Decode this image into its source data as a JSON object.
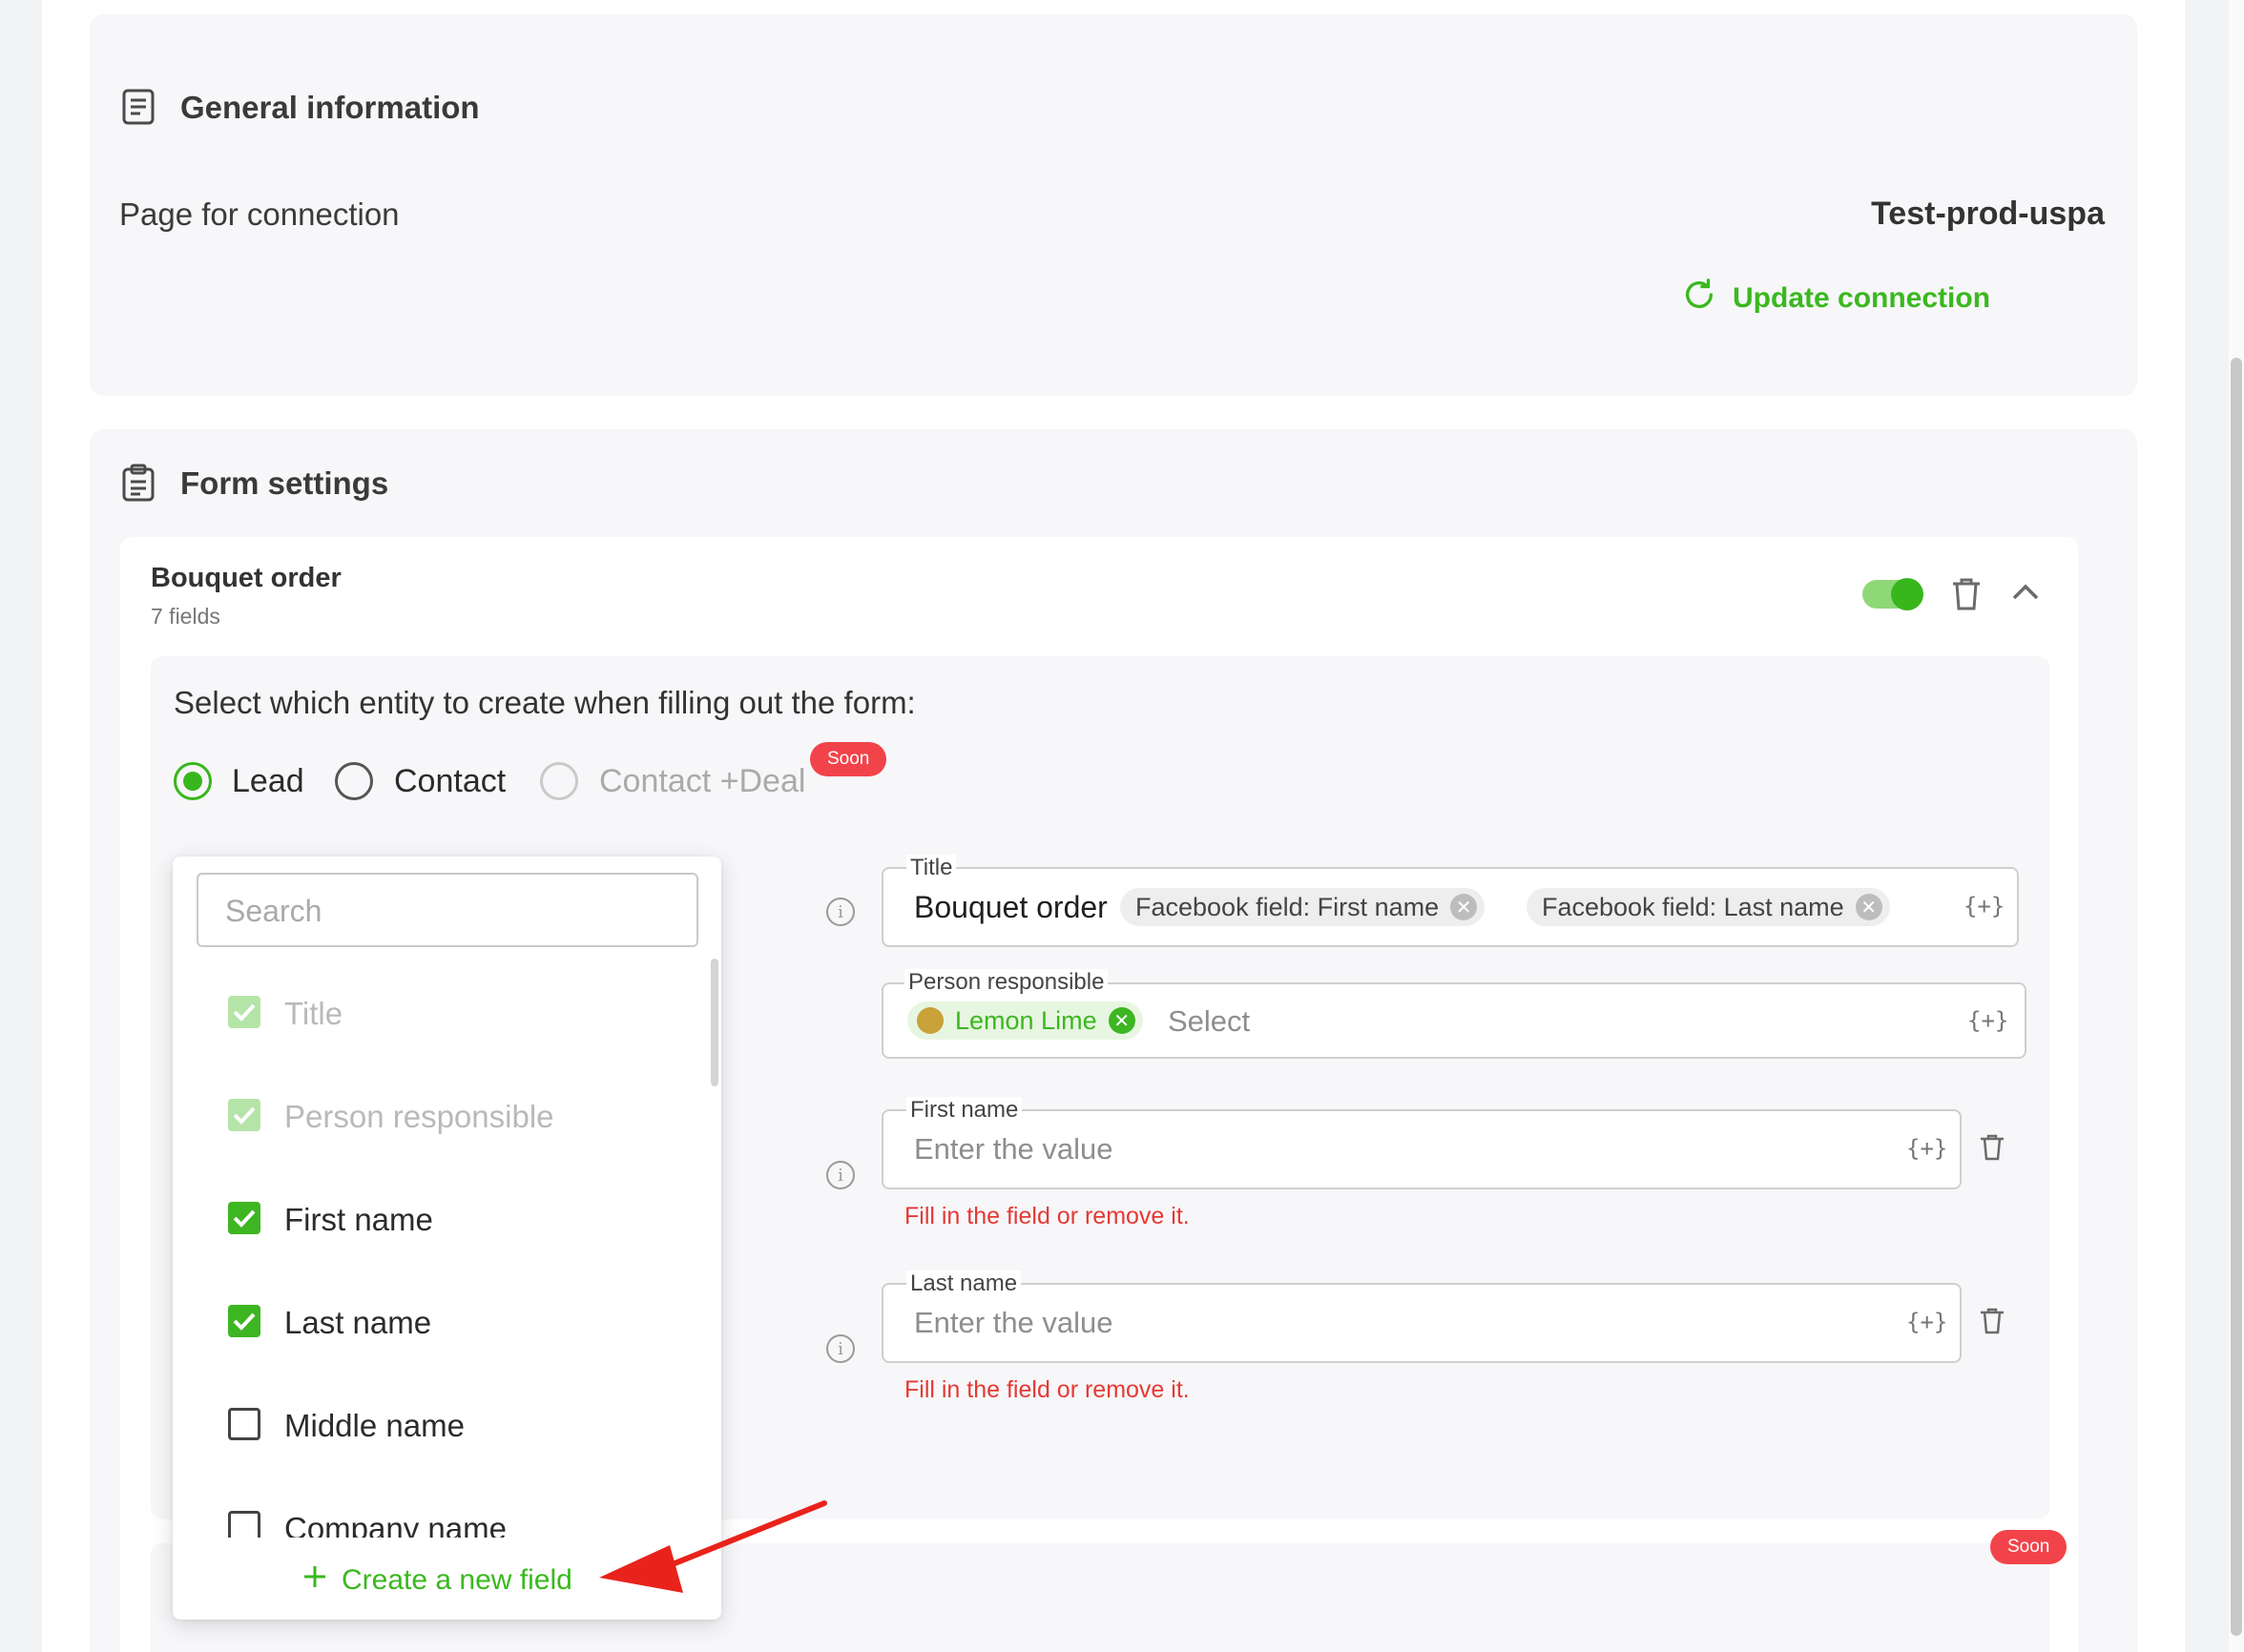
{
  "general": {
    "title": "General information",
    "connection_label": "Page for connection",
    "connection_value": "Test-prod-uspa",
    "update_button": "Update connection"
  },
  "form_settings": {
    "title": "Form settings",
    "form": {
      "name": "Bouquet order",
      "field_count": "7 fields",
      "enabled": true
    },
    "entity_prompt": "Select which entity to create when filling out the form:",
    "entity_options": [
      {
        "label": "Lead",
        "selected": true
      },
      {
        "label": "Contact",
        "selected": false
      },
      {
        "label": "Contact +Deal",
        "selected": false,
        "disabled": true
      }
    ],
    "soon_badge": "Soon",
    "soon_badge_lower": "Soon"
  },
  "dropdown": {
    "search_placeholder": "Search",
    "options": [
      {
        "label": "Title",
        "checked": true,
        "locked": true
      },
      {
        "label": "Person responsible",
        "checked": true,
        "locked": true
      },
      {
        "label": "First name",
        "checked": true
      },
      {
        "label": "Last name",
        "checked": true
      },
      {
        "label": "Middle name",
        "checked": false
      },
      {
        "label": "Company name",
        "checked": false
      }
    ],
    "create_button": "Create a new field"
  },
  "fields": {
    "title": {
      "legend": "Title",
      "value": "Bouquet order",
      "chips": [
        "Facebook field: First name",
        "Facebook field: Last name"
      ],
      "var_icon": "{+}"
    },
    "responsible": {
      "legend": "Person responsible",
      "chip": "Lemon Lime",
      "placeholder": "Select",
      "var_icon": "{+}"
    },
    "first_name": {
      "legend": "First name",
      "placeholder": "Enter the value",
      "error": "Fill in the field or remove it.",
      "var_icon": "{+}"
    },
    "last_name": {
      "legend": "Last name",
      "placeholder": "Enter the value",
      "error": "Fill in the field or remove it.",
      "var_icon": "{+}"
    }
  },
  "colors": {
    "accent": "#3ab81f",
    "error": "#e53935",
    "badge": "#f2434a"
  }
}
